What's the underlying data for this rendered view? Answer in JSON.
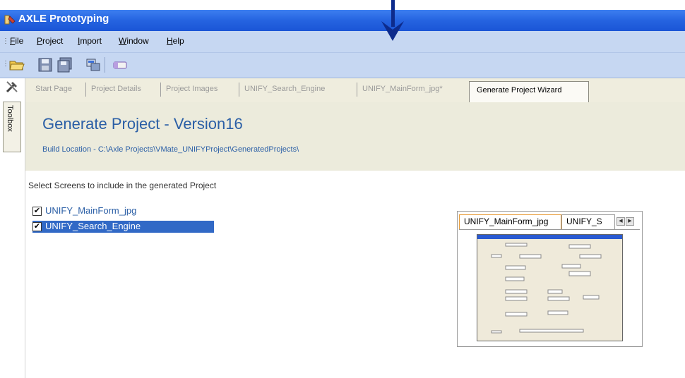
{
  "window": {
    "title": "AXLE Prototyping"
  },
  "menu": [
    {
      "label": "File",
      "underline": "F"
    },
    {
      "label": "Project",
      "underline": "P"
    },
    {
      "label": "Import",
      "underline": "I"
    },
    {
      "label": "Window",
      "underline": "W"
    },
    {
      "label": "Help",
      "underline": "H"
    }
  ],
  "toolbox": {
    "label": "Toolbox"
  },
  "tabs": [
    {
      "label": "Start Page"
    },
    {
      "label": "Project Details"
    },
    {
      "label": "Project Images"
    },
    {
      "label": "UNIFY_Search_Engine"
    },
    {
      "label": "UNIFY_MainForm_jpg*"
    }
  ],
  "active_tab": {
    "label": "Generate Project Wizard"
  },
  "header": {
    "title": "Generate Project - Version16",
    "build_location": "Build Location  - C:\\Axle Projects\\VMate_UNIFYProject\\GeneratedProjects\\"
  },
  "body": {
    "select_label": "Select Screens to include in the generated Project",
    "screens": [
      {
        "label": "UNIFY_MainForm_jpg",
        "checked": true,
        "selected": false
      },
      {
        "label": "UNIFY_Search_Engine",
        "checked": true,
        "selected": true
      }
    ]
  },
  "preview": {
    "tabs": [
      {
        "label": "UNIFY_MainForm_jpg"
      },
      {
        "label": "UNIFY_S"
      }
    ]
  },
  "colors": {
    "title_bar": "#2563e0",
    "menu_bg": "#c6d7f2",
    "link_blue": "#2b5fa6",
    "selection": "#3169c6",
    "arrow": "#0d2b8c"
  }
}
